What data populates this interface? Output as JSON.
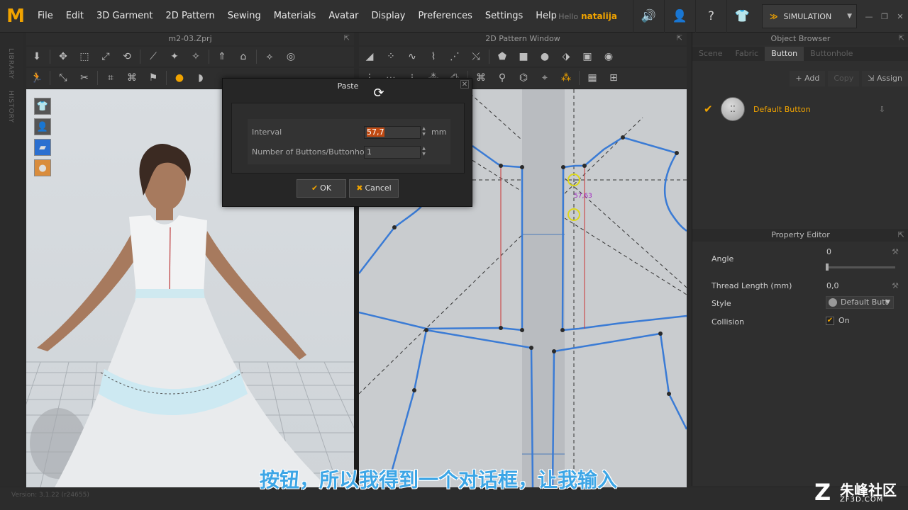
{
  "menubar": {
    "logo": "M",
    "items": [
      "File",
      "Edit",
      "3D Garment",
      "2D Pattern",
      "Sewing",
      "Materials",
      "Avatar",
      "Display",
      "Preferences",
      "Settings",
      "Help"
    ],
    "hello": "Hello",
    "username": "natalija",
    "simulation_label": "SIMULATION",
    "icons": [
      "speaker-icon",
      "user-icon",
      "help-icon",
      "shirt-icon"
    ]
  },
  "side_tabs": [
    "LIBRARY",
    "HISTORY"
  ],
  "panel_3d": {
    "title": "m2-03.Zprj"
  },
  "panel_2d": {
    "title": "2D Pattern Window"
  },
  "pattern_measure": "57,63",
  "object_browser": {
    "title": "Object Browser",
    "tabs": [
      "Scene",
      "Fabric",
      "Button",
      "Buttonhole"
    ],
    "active_tab": "Button",
    "actions": {
      "add": "Add",
      "copy": "Copy",
      "assign": "Assign"
    },
    "items": [
      {
        "name": "Default Button"
      }
    ]
  },
  "property_editor": {
    "title": "Property Editor",
    "angle_label": "Angle",
    "angle_value": "0",
    "angle_slider_fraction": 0,
    "thread_label": "Thread Length (mm)",
    "thread_value": "0,0",
    "style_label": "Style",
    "style_value": "Default Butt",
    "collision_label": "Collision",
    "collision_value": "On"
  },
  "dialog": {
    "title": "Paste",
    "interval_label": "Interval",
    "interval_value": "57,7",
    "interval_unit": "mm",
    "count_label": "Number of Buttons/Buttonholes",
    "count_value": "1",
    "ok_label": "OK",
    "cancel_label": "Cancel"
  },
  "footer": {
    "version": "Version: 3.1.22     (r24655)",
    "subtitle": "按钮，所以我得到一个对话框，让我输入",
    "watermark_cn": "朱峰社区",
    "watermark_url": "ZF3D.COM"
  },
  "colors": {
    "accent": "#f0a300",
    "pattern_line": "#3a7bd5",
    "subtitle": "#3da6e6"
  }
}
